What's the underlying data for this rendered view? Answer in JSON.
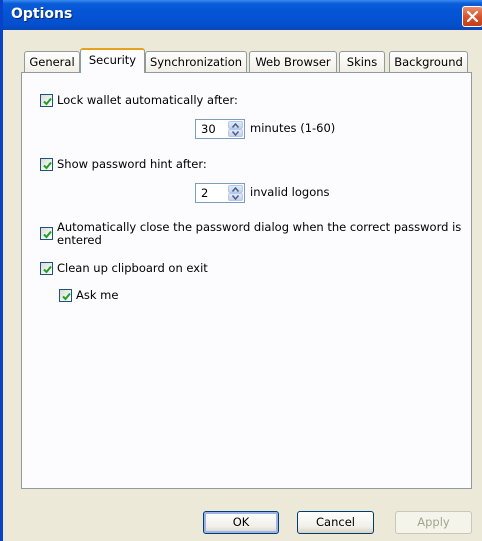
{
  "window": {
    "title": "Options"
  },
  "tabs": [
    {
      "label": "General"
    },
    {
      "label": "Security"
    },
    {
      "label": "Synchronization"
    },
    {
      "label": "Web Browser"
    },
    {
      "label": "Skins"
    },
    {
      "label": "Background"
    }
  ],
  "active_tab": "Security",
  "security": {
    "lock_wallet": {
      "label": "Lock wallet automatically after:",
      "checked": true
    },
    "lock_minutes": {
      "value": "30",
      "suffix": "minutes (1-60)"
    },
    "show_hint": {
      "label": "Show password hint after:",
      "checked": true
    },
    "hint_logons": {
      "value": "2",
      "suffix": "invalid logons"
    },
    "auto_close": {
      "label": "Automatically close the password dialog when the correct password is entered",
      "checked": true
    },
    "clean_clipboard": {
      "label": "Clean up clipboard on exit",
      "checked": true
    },
    "ask_me": {
      "label": "Ask me",
      "checked": true
    }
  },
  "buttons": {
    "ok": "OK",
    "cancel": "Cancel",
    "apply": "Apply"
  },
  "colors": {
    "titlebar": "#0455d6",
    "active_tab_accent": "#e6a11d",
    "checkmark": "#21a121",
    "close_button": "#d9542c"
  }
}
